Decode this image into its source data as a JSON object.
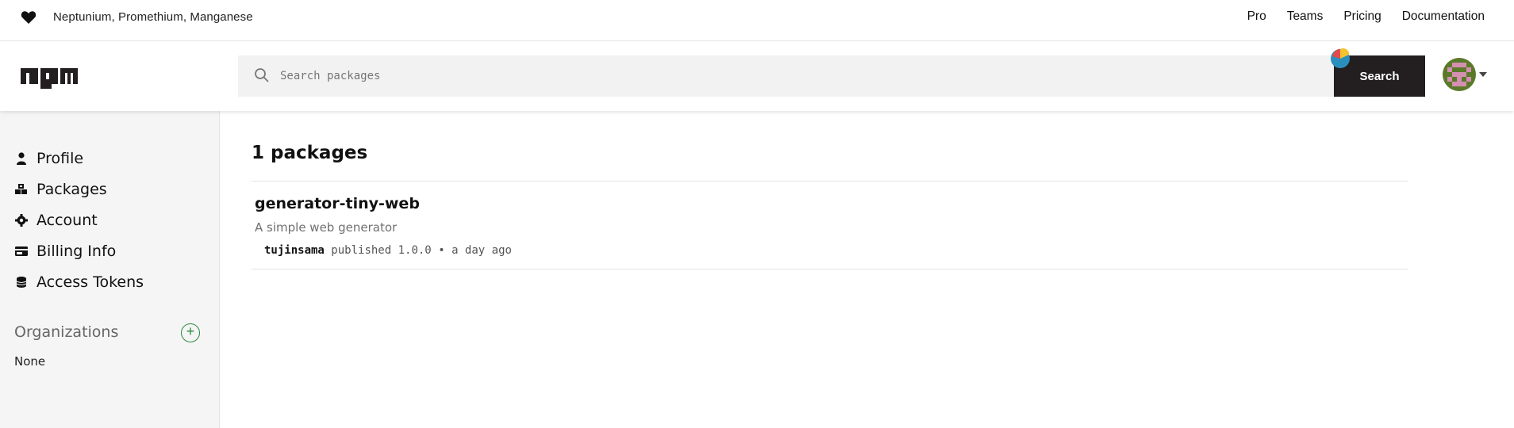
{
  "top_strip": {
    "tagline": "Neptunium, Promethium, Manganese",
    "nav": [
      "Pro",
      "Teams",
      "Pricing",
      "Documentation"
    ]
  },
  "header": {
    "logo": "npm",
    "search_placeholder": "Search packages",
    "search_value": "",
    "search_button": "Search"
  },
  "sidebar": {
    "items": [
      {
        "label": "Profile",
        "icon": "user-icon"
      },
      {
        "label": "Packages",
        "icon": "cubes-icon"
      },
      {
        "label": "Account",
        "icon": "gear-icon"
      },
      {
        "label": "Billing Info",
        "icon": "credit-card-icon"
      },
      {
        "label": "Access Tokens",
        "icon": "tokens-icon"
      }
    ],
    "organizations_heading": "Organizations",
    "organizations_add": "+",
    "organizations_value": "None"
  },
  "main": {
    "title": "1 packages",
    "packages": [
      {
        "name": "generator-tiny-web",
        "description": "A simple web generator",
        "author": "tujinsama",
        "published": "published",
        "version": "1.0.0",
        "separator": "•",
        "time": "a day ago"
      }
    ]
  },
  "colors": {
    "accent_dark": "#231f20",
    "org_add_green": "#2b8a3e",
    "sidebar_bg": "#f5f5f5"
  }
}
